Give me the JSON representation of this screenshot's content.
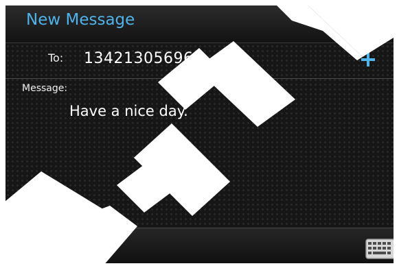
{
  "header": {
    "title": "New Message"
  },
  "recipient": {
    "label": "To:",
    "value": "13421305696"
  },
  "message": {
    "label": "Message:",
    "body": "Have a nice day."
  },
  "colors": {
    "accent": "#4fb3ec",
    "background": "#161616",
    "text": "#ffffff"
  },
  "icons": {
    "back": "back-arrow-icon",
    "add": "plus-icon",
    "send": "envelope-send-icon",
    "keyboard": "keyboard-icon"
  }
}
